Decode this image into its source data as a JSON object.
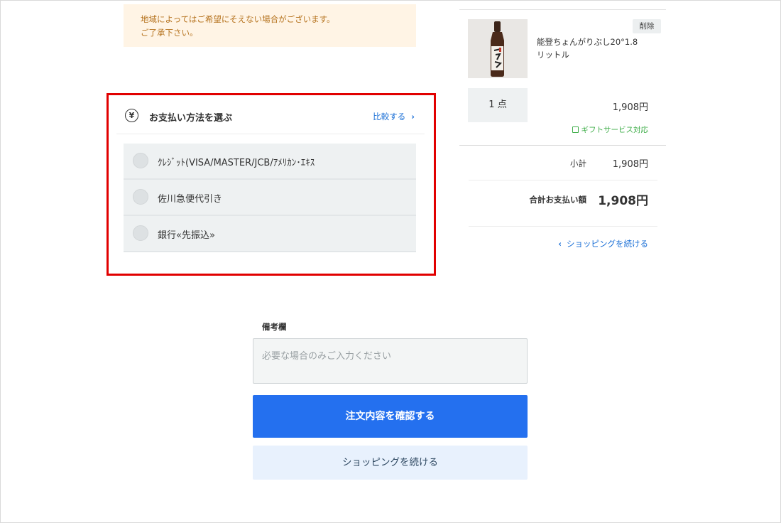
{
  "notice": {
    "line1": "地域によってはご希望にそえない場合がございます。",
    "line2": "ご了承下さい。"
  },
  "payment": {
    "title": "お支払い方法を選ぶ",
    "compare_label": "比較する",
    "options": [
      {
        "label": "ｸﾚｼﾞｯﾄ(VISA/MASTER/JCB/ｱﾒﾘｶﾝ･ｴｷｽ",
        "selected": false
      },
      {
        "label": "佐川急便代引き",
        "selected": false
      },
      {
        "label": "銀行«先振込»",
        "selected": false
      }
    ]
  },
  "cart": {
    "delete_label": "削除",
    "product_name": "能登ちょんがりぶし20°1.8リットル",
    "quantity": "1 点",
    "price": "1,908円",
    "gift_label": "ギフトサービス対応",
    "subtotal_label": "小計",
    "subtotal_value": "1,908円",
    "total_label": "合計お支払い額",
    "total_value": "1,908円",
    "continue_link": "ショッピングを続ける"
  },
  "notes": {
    "label": "備考欄",
    "placeholder": "必要な場合のみご入力ください"
  },
  "actions": {
    "confirm": "注文内容を確認する",
    "continue": "ショッピングを続ける"
  },
  "colors": {
    "accent": "#2470ef",
    "link": "#1a6fd6",
    "highlight": "#e10000",
    "gift": "#3fae49",
    "notice_bg": "#fff4e5",
    "notice_text": "#b5721d"
  }
}
